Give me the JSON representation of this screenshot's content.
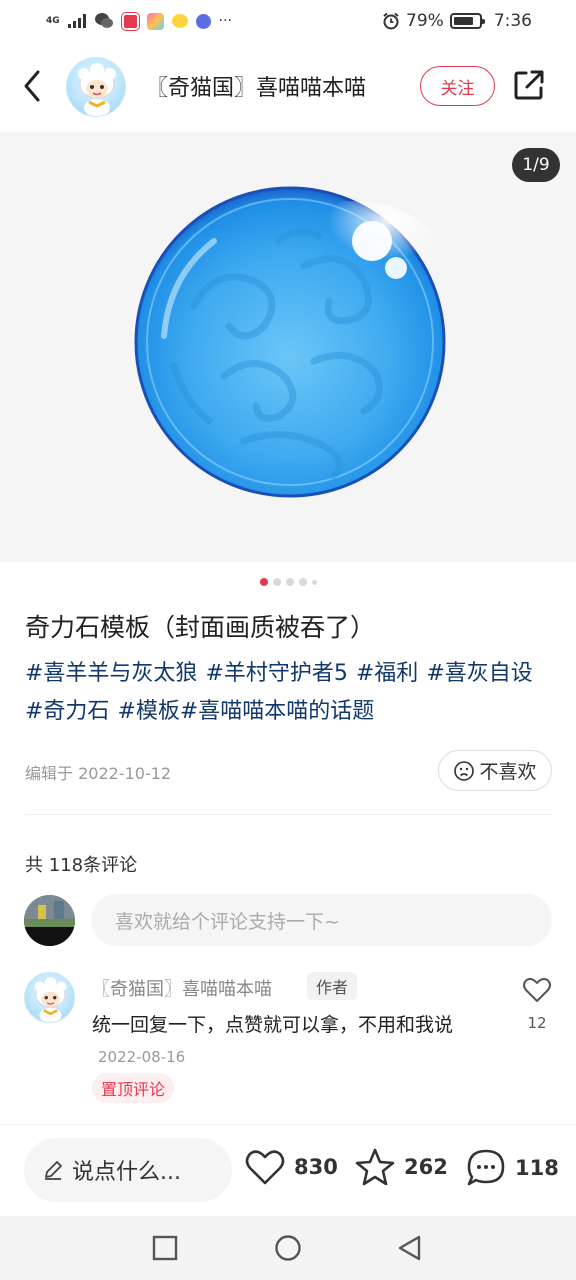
{
  "status_bar": {
    "network": "4G",
    "battery": "79%",
    "battery_level": 0.79,
    "time": "7:36",
    "more": "···"
  },
  "header": {
    "author_name": "〖奇猫国〗喜喵喵本喵",
    "follow_label": "关注"
  },
  "gallery": {
    "counter": "1/9",
    "current": 1,
    "total": 9
  },
  "post": {
    "title": "奇力石模板（封面画质被吞了）",
    "tags": [
      "#喜羊羊与灰太狼",
      "#羊村守护者5",
      "#福利",
      "#喜灰自设",
      "#奇力石",
      "#模板",
      "#喜喵喵本喵的话题"
    ],
    "edit_date": "编辑于 2022-10-12",
    "dislike_label": "不喜欢"
  },
  "comments": {
    "count_label": "共 118条评论",
    "input_placeholder": "喜欢就给个评论支持一下~",
    "items": [
      {
        "author": "〖奇猫国〗喜喵喵本喵",
        "badge": "作者",
        "text": "统一回复一下，点赞就可以拿，不用和我说",
        "time": "2022-08-16",
        "pinned_label": "置顶评论",
        "likes": "12"
      }
    ]
  },
  "bottom_bar": {
    "say_label": "说点什么...",
    "likes": "830",
    "favorites": "262",
    "comments": "118"
  },
  "colors": {
    "accent": "#e53950",
    "tag": "#13386c",
    "orb": "#2fa3ee"
  },
  "icons": {
    "back": "chevron-left-icon",
    "share": "share-icon",
    "dislike": "sad-face-icon",
    "like": "heart-icon",
    "favorite": "star-icon",
    "comment": "chat-bubble-icon",
    "edit": "pencil-icon"
  }
}
